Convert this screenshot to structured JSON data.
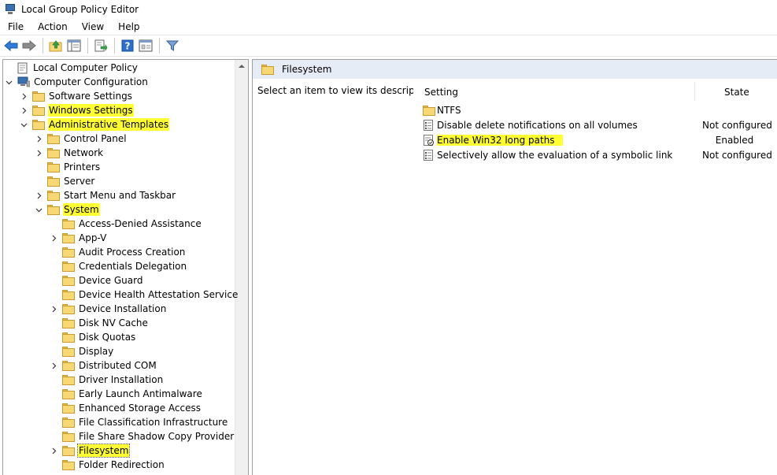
{
  "window": {
    "title": "Local Group Policy Editor"
  },
  "menu": [
    "File",
    "Action",
    "View",
    "Help"
  ],
  "toolbar": {
    "buttons": [
      "back-arrow-icon",
      "forward-arrow-icon",
      "up-folder-icon",
      "show-hide-tree-icon",
      "export-list-icon",
      "help-icon",
      "properties-icon",
      "filter-icon"
    ]
  },
  "tree": {
    "root": "Local Computer Policy",
    "computer_config": "Computer Configuration",
    "software_settings": "Software Settings",
    "windows_settings": "Windows Settings",
    "admin_templates": "Administrative Templates",
    "control_panel": "Control Panel",
    "network": "Network",
    "printers": "Printers",
    "server": "Server",
    "start_menu": "Start Menu and Taskbar",
    "system": "System",
    "system_children": [
      "Access-Denied Assistance",
      "App-V",
      "Audit Process Creation",
      "Credentials Delegation",
      "Device Guard",
      "Device Health Attestation Service",
      "Device Installation",
      "Disk NV Cache",
      "Disk Quotas",
      "Display",
      "Distributed COM",
      "Driver Installation",
      "Early Launch Antimalware",
      "Enhanced Storage Access",
      "File Classification Infrastructure",
      "File Share Shadow Copy Provider",
      "Filesystem",
      "Folder Redirection"
    ]
  },
  "right": {
    "header": "Filesystem",
    "description": "Select an item to view its description.",
    "columns": {
      "setting": "Setting",
      "state": "State"
    },
    "rows": [
      {
        "name": "NTFS",
        "state": ""
      },
      {
        "name": "Disable delete notifications on all volumes",
        "state": "Not configured"
      },
      {
        "name": "Enable Win32 long paths",
        "state": "Enabled"
      },
      {
        "name": "Selectively allow the evaluation of a symbolic link",
        "state": "Not configured"
      }
    ]
  },
  "colors": {
    "highlight": "#ffff33",
    "header_bg": "#e6ecf5",
    "folder": "#f8d775"
  }
}
